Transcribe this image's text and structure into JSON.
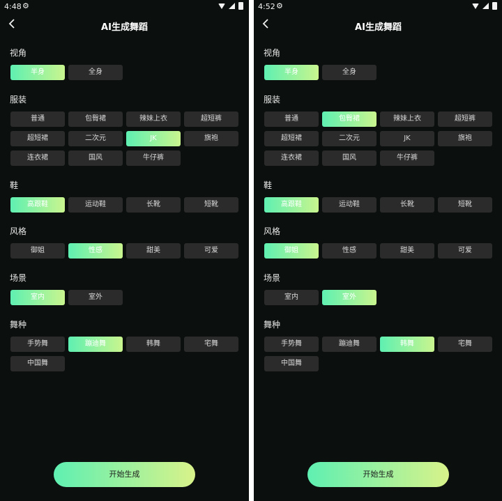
{
  "left": {
    "status": {
      "time": "4:48",
      "gear": "⚙"
    },
    "title": "AI生成舞蹈",
    "sections": [
      {
        "label": "视角",
        "chips": [
          {
            "label": "半身",
            "selected": true
          },
          {
            "label": "全身",
            "selected": false
          }
        ]
      },
      {
        "label": "服装",
        "chips": [
          {
            "label": "普通",
            "selected": false
          },
          {
            "label": "包臀裙",
            "selected": false
          },
          {
            "label": "辣妹上衣",
            "selected": false
          },
          {
            "label": "超短裤",
            "selected": false
          },
          {
            "label": "超短裙",
            "selected": false
          },
          {
            "label": "二次元",
            "selected": false
          },
          {
            "label": "JK",
            "selected": true
          },
          {
            "label": "旗袍",
            "selected": false
          },
          {
            "label": "连衣裙",
            "selected": false
          },
          {
            "label": "国风",
            "selected": false
          },
          {
            "label": "牛仔裤",
            "selected": false
          }
        ]
      },
      {
        "label": "鞋",
        "chips": [
          {
            "label": "高跟鞋",
            "selected": true
          },
          {
            "label": "运动鞋",
            "selected": false
          },
          {
            "label": "长靴",
            "selected": false
          },
          {
            "label": "短靴",
            "selected": false
          }
        ]
      },
      {
        "label": "风格",
        "chips": [
          {
            "label": "御姐",
            "selected": false
          },
          {
            "label": "性感",
            "selected": true
          },
          {
            "label": "甜美",
            "selected": false
          },
          {
            "label": "可爱",
            "selected": false
          }
        ]
      },
      {
        "label": "场景",
        "chips": [
          {
            "label": "室内",
            "selected": true
          },
          {
            "label": "室外",
            "selected": false
          }
        ]
      },
      {
        "label": "舞种",
        "chips": [
          {
            "label": "手势舞",
            "selected": false
          },
          {
            "label": "蹦迪舞",
            "selected": true
          },
          {
            "label": "韩舞",
            "selected": false
          },
          {
            "label": "宅舞",
            "selected": false
          },
          {
            "label": "中国舞",
            "selected": false
          }
        ]
      }
    ],
    "start_label": "开始生成"
  },
  "right": {
    "status": {
      "time": "4:52",
      "gear": "⚙"
    },
    "title": "AI生成舞蹈",
    "sections": [
      {
        "label": "视角",
        "chips": [
          {
            "label": "半身",
            "selected": true
          },
          {
            "label": "全身",
            "selected": false
          }
        ]
      },
      {
        "label": "服装",
        "chips": [
          {
            "label": "普通",
            "selected": false
          },
          {
            "label": "包臀裙",
            "selected": true
          },
          {
            "label": "辣妹上衣",
            "selected": false
          },
          {
            "label": "超短裤",
            "selected": false
          },
          {
            "label": "超短裙",
            "selected": false
          },
          {
            "label": "二次元",
            "selected": false
          },
          {
            "label": "JK",
            "selected": false
          },
          {
            "label": "旗袍",
            "selected": false
          },
          {
            "label": "连衣裙",
            "selected": false
          },
          {
            "label": "国风",
            "selected": false
          },
          {
            "label": "牛仔裤",
            "selected": false
          }
        ]
      },
      {
        "label": "鞋",
        "chips": [
          {
            "label": "高跟鞋",
            "selected": true
          },
          {
            "label": "运动鞋",
            "selected": false
          },
          {
            "label": "长靴",
            "selected": false
          },
          {
            "label": "短靴",
            "selected": false
          }
        ]
      },
      {
        "label": "风格",
        "chips": [
          {
            "label": "御姐",
            "selected": true
          },
          {
            "label": "性感",
            "selected": false
          },
          {
            "label": "甜美",
            "selected": false
          },
          {
            "label": "可爱",
            "selected": false
          }
        ]
      },
      {
        "label": "场景",
        "chips": [
          {
            "label": "室内",
            "selected": false
          },
          {
            "label": "室外",
            "selected": true
          }
        ]
      },
      {
        "label": "舞种",
        "chips": [
          {
            "label": "手势舞",
            "selected": false
          },
          {
            "label": "蹦迪舞",
            "selected": false
          },
          {
            "label": "韩舞",
            "selected": true
          },
          {
            "label": "宅舞",
            "selected": false
          },
          {
            "label": "中国舞",
            "selected": false
          }
        ]
      }
    ],
    "start_label": "开始生成"
  }
}
